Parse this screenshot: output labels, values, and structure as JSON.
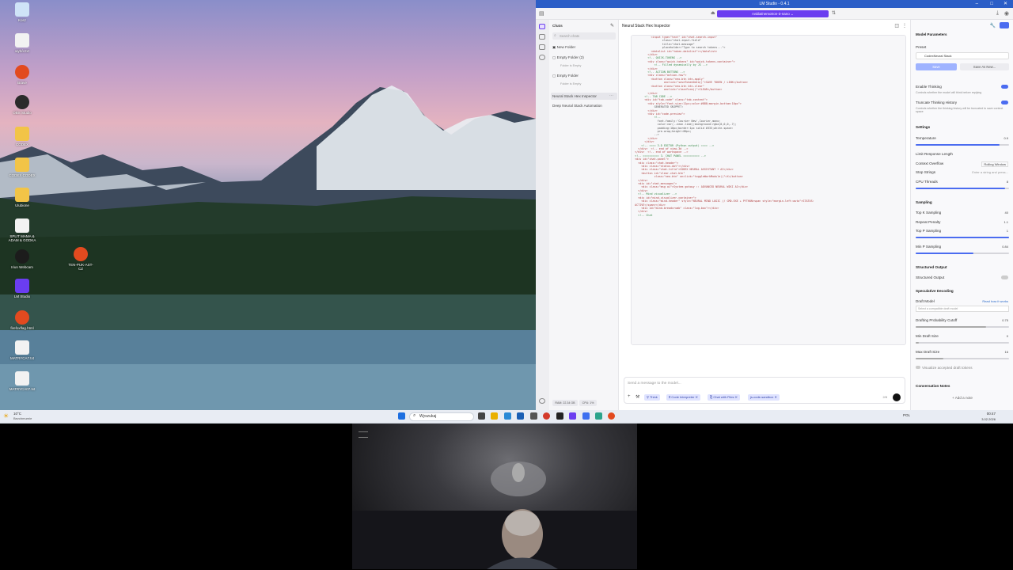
{
  "desktop": {
    "icons": [
      {
        "label": "Kosz",
        "icon": "recycle-bin-icon"
      },
      {
        "label": "wybór.txt",
        "icon": "text-file-icon"
      },
      {
        "label": "Brave",
        "icon": "brave-icon"
      },
      {
        "label": "OBS Studio",
        "icon": "obs-icon"
      },
      {
        "label": "CODEX",
        "icon": "folder-icon"
      },
      {
        "label": "CODEX CODEX",
        "icon": "folder-icon"
      },
      {
        "label": "Ulubione",
        "icon": "folder-icon"
      },
      {
        "label": "SPLIT MAMA & ADAM & GODKA",
        "icon": "text-file-icon"
      },
      {
        "label": "Iriun Webcam",
        "icon": "webcam-icon"
      },
      {
        "label": "LM Studio",
        "icon": "lm-studio-icon"
      },
      {
        "label": "firefoxflag.html",
        "icon": "brave-icon"
      },
      {
        "label": "MATRYCA7.txt",
        "icon": "text-file-icon"
      },
      {
        "label": "MATRYCA07.txt",
        "icon": "text-file-icon"
      },
      {
        "label": "TEN-PUK-AST-CZ",
        "icon": "brave-icon"
      }
    ]
  },
  "lmstudio": {
    "window_title": "LM Studio - 0.4.1",
    "model_picker": "nvidia/nemotron-3-nano",
    "chats_header": "Chats",
    "search_placeholder": "Search chats",
    "new_folder": "New Folder",
    "folders": [
      {
        "name": "Empty Folder (2)",
        "note": "Folder is Empty"
      },
      {
        "name": "Empty Folder",
        "note": "Folder is Empty"
      }
    ],
    "chat_items": [
      "Neural Stack Hex Inspector",
      "Deep Neural Stack Automation"
    ],
    "active_chat_title": "Neural Stack Hex Inspector",
    "code_lines": [
      "            <input type=\"text\" id=\"chat-search-input\"",
      "                   class=\"chat-input-field\"",
      "                   title=\"chat-message\"",
      "                   placeholder=\"Type to search tokens...\">",
      "            <datalist id=\"token-datalist\"></datalist>",
      "          </div>",
      "",
      "          <!-- QUICK-TOKENS -->",
      "          <div class=\"quick-tokens\" id=\"quick-tokens-container\">",
      "              <!-- Filled dynamically by JS -->",
      "          </div>",
      "",
      "          <!-- ACTION BUTTONS -->",
      "          <div class=\"action-row\">",
      "            <button class=\"neo-btn btn-apply\"",
      "                    onclick=\"saveTokenData()\">SAVE TOKEN / LINK</button>",
      "            <button class=\"neo-btn btn-clear\"",
      "                    onclick=\"clearForm()\">CLEAR</button>",
      "          </div>",
      "",
      "        <!-- TAB CODE -->",
      "        <div id=\"tab-code\" class=\"tab-content\">",
      "          <div style=\"font-size:11px;color:#888;margin-bottom:10px\">",
      "              GENERATED SNIPPET:",
      "          </div>",
      "          <div id=\"code-preview\">",
      "              <!-- ",
      "                font-family:'Courier New',Courier,mono;",
      "                color:var(--neon-lime);background:rgba(0,0,0,.7);",
      "                padding:10px;border:1px solid #333;white-space:",
      "                pre-wrap;height:80px;",
      "              -->",
      "          </div>",
      "        </div>",
      "",
      "      <!-- ==== 3-D EDITOR (Python output) ==== -->",
      "    </div>  <!-- end of view-3d -->",
      "",
      "  </div>  <!-- end of workspace -->",
      "",
      "  <!-- ========== 3. CHAT PANEL ========== -->",
      "  <div id=\"chat-panel\">",
      "    <div class=\"chat-header\">",
      "      <div class=\"status-dot\"></div>",
      "      <div class=\"chat-title\">CODEX NEURAL ASSISTANT • AI</div>",
      "      <button id=\"clear-chat-btn\"",
      "              class=\"neo-btn\" onclick=\"toggleWorkModule()\">X</button>",
      "    </div>",
      "",
      "    <div id=\"chat-messages\">",
      "      <div class=\"msg ai\">System gotowy :: ADVANCED NEURAL WIKI AI</div>",
      "    </div>",
      "",
      "    <!-- Mind visualizer -->",
      "    <div id=\"mind-visualizer-container\">",
      "      <div class=\"mind-header\" style=\"NEURAL MIND LOGIC // CMD.EXE + PYTHON<span style=\"margin-left:auto\">STATUS:",
      "  ACTIVE</span></div>",
      "      <div id=\"mind-breadcrumb\" class=\"log-box\"></div>",
      "    </div>",
      "",
      "    <!-- Chat"
    ],
    "composer": {
      "placeholder": "Send a message to the model...",
      "chips": [
        "Think",
        "Code Interpreter",
        "Chat with Files",
        "js-code-sandbox"
      ],
      "token_count": "2/8"
    },
    "bottom_stats": {
      "ram": "RAM: 22.34 GB",
      "cpu": "CPU: 1%"
    },
    "params": {
      "header": "Model Parameters",
      "preset_label": "Preset",
      "preset_value": "CodexNeural Stack",
      "save_label": "Save",
      "save_as_label": "Save As New...",
      "enable_thinking": "Enable Thinking",
      "enable_thinking_desc": "Controls whether the model will think before replying",
      "truncate_thinking": "Truncate Thinking History",
      "truncate_thinking_desc": "Controls whether the thinking history will be truncated to save context space",
      "settings_header": "Settings",
      "temperature_label": "Temperature",
      "temperature_value": "0.9",
      "temperature_fraction": 0.9,
      "limit_response": "Limit Response Length",
      "context_overflow": "Context Overflow",
      "context_overflow_value": "Rolling Window",
      "stop_strings": "Stop Strings",
      "stop_strings_placeholder": "Enter a string and press...",
      "cpu_threads": "CPU Threads",
      "cpu_threads_value": "8",
      "sampling_header": "Sampling",
      "top_k_label": "Top K Sampling",
      "top_k_value": "40",
      "repeat_penalty_label": "Repeat Penalty",
      "repeat_penalty_value": "1.1",
      "top_p_label": "Top P Sampling",
      "top_p_value": "1",
      "min_p_label": "Min P Sampling",
      "min_p_value": "0.84",
      "structured_header": "Structured Output",
      "structured_label": "Structured Output",
      "spec_header": "Speculative Decoding",
      "draft_model_label": "Draft Model",
      "draft_model_link": "Read how it works",
      "draft_model_placeholder": "Select a compatible draft model",
      "drafting_prob_label": "Drafting Probability Cutoff",
      "drafting_prob_value": "0.75",
      "min_draft_label": "Min Draft Size",
      "min_draft_value": "0",
      "max_draft_label": "Max Draft Size",
      "max_draft_value": "16",
      "visualize_label": "Visualize accepted draft tokens",
      "notes_header": "Conversation Notes",
      "add_note": "+ Add a note"
    }
  },
  "taskbar": {
    "weather_temp": "10°C",
    "weather_desc": "Bezchmurnie",
    "search_text": "Wyszukaj",
    "time": "00:47",
    "date": "3.02.2026",
    "lang": "POL"
  },
  "colors": {
    "accent": "#6a3df0",
    "titlebar": "#2b5ec7",
    "chip_bg": "#dfe3ff",
    "slider": "#4b6cf0"
  }
}
